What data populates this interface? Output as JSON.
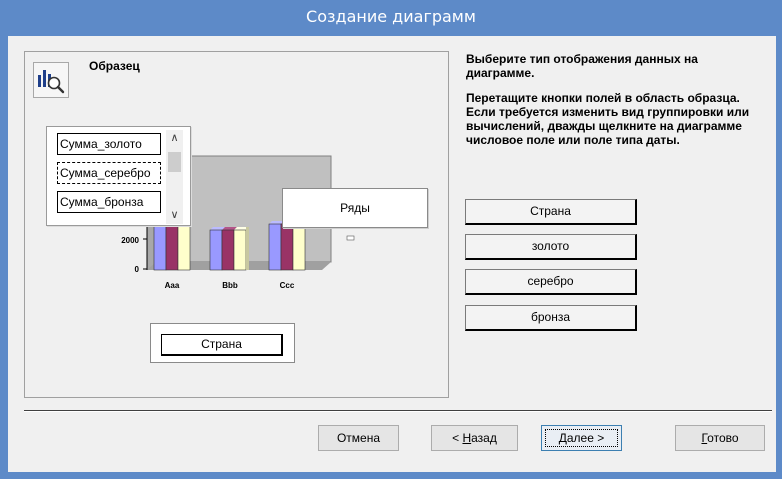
{
  "window": {
    "title": "Создание диаграмм"
  },
  "sample": {
    "label": "Образец",
    "icon": "chart-preview-icon",
    "data_fields": [
      "Сумма_золото",
      "Сумма_серебро",
      "Сумма_бронза"
    ],
    "series_drop_label": "Ряды",
    "category_field": "Страна",
    "chart": {
      "categories": [
        "Aaa",
        "Bbb",
        "Ccc"
      ],
      "y_ticks": [
        "2000",
        "0"
      ],
      "colors": [
        "#9999ff",
        "#993366",
        "#ffffcc"
      ]
    }
  },
  "instructions": {
    "line1": "Выберите тип отображения данных на диаграмме.",
    "line2": "Перетащите кнопки полей в область образца. Если требуется изменить вид группировки или вычислений, дважды щелкните на диаграмме числовое поле или поле типа даты."
  },
  "fields": [
    "Страна",
    "золото",
    "серебро",
    "бронза"
  ],
  "buttons": {
    "cancel": "Отмена",
    "back_prefix": "< ",
    "back_mnemonic": "Н",
    "back_rest": "азад",
    "next_mnemonic": "Д",
    "next_rest": "алее >",
    "finish_mnemonic": "Г",
    "finish_rest": "отово"
  }
}
